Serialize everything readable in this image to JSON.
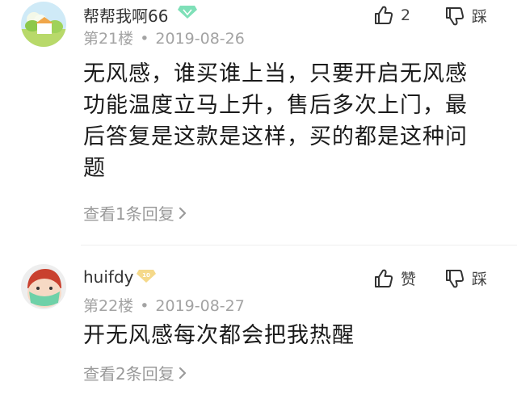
{
  "comments": [
    {
      "username": "帮帮我啊66",
      "floor": "第21楼",
      "date": "2019-08-26",
      "like_label": "2",
      "dislike_label": "踩",
      "body": "无风感，谁买谁上当，只要开启无风感功能温度立马上升，售后多次上门，最后答复是这款是这样，买的都是这种问题",
      "replies_label": "查看1条回复",
      "badge_color": "#7fe0b8"
    },
    {
      "username": "huifdy",
      "floor": "第22楼",
      "date": "2019-08-27",
      "badge_text": "10",
      "like_label": "赞",
      "dislike_label": "踩",
      "body": "开无风感每次都会把我热醒",
      "replies_label": "查看2条回复",
      "badge_color": "#f5d98a"
    }
  ],
  "separator_dot": "•",
  "icons": {
    "like": "thumbs-up-icon",
    "dislike": "thumbs-down-icon",
    "chevron": "chevron-right-icon"
  }
}
